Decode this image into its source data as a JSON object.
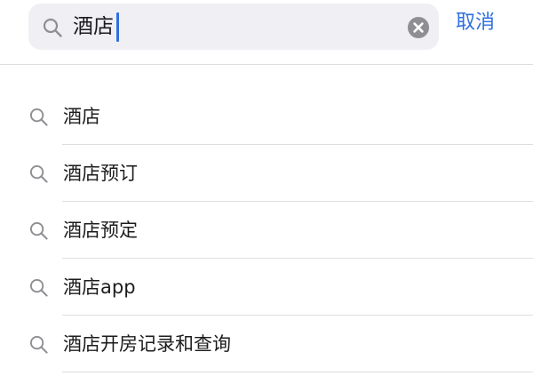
{
  "search": {
    "query": "酒店",
    "cancel_label": "取消"
  },
  "suggestions": [
    {
      "label": "酒店"
    },
    {
      "label": "酒店预订"
    },
    {
      "label": "酒店预定"
    },
    {
      "label": "酒店app"
    },
    {
      "label": "酒店开房记录和查询"
    }
  ],
  "icons": {
    "field_search": "search-icon",
    "clear": "clear-icon",
    "suggestion": "search-icon"
  },
  "colors": {
    "accent": "#2f6fe0",
    "field_background": "#efeff4",
    "icon_gray": "#8e8e93",
    "clear_icon_gray": "#8e8e93",
    "divider": "#dedee2",
    "text": "#1c1c1e"
  }
}
